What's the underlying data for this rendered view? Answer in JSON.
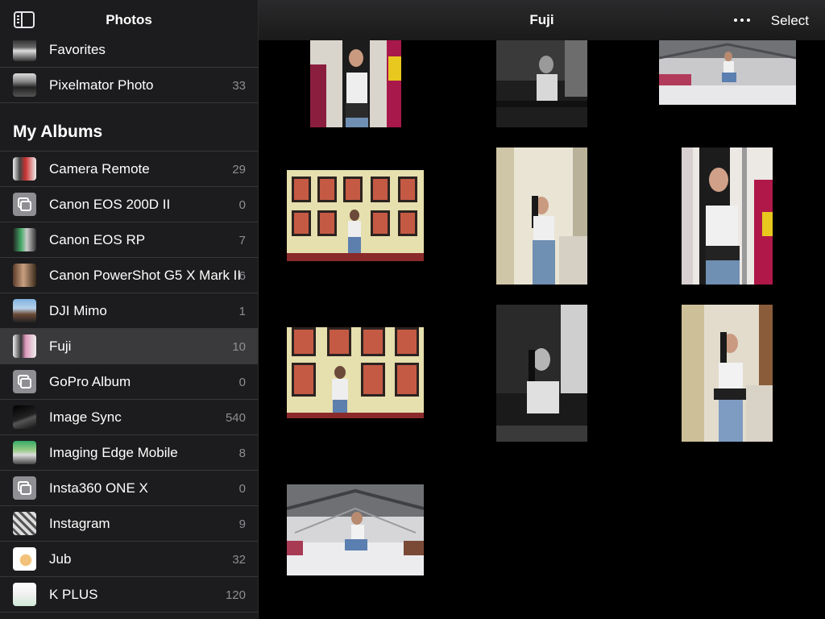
{
  "sidebar": {
    "title": "Photos",
    "top_items": [
      {
        "label": "Favorites",
        "count": ""
      },
      {
        "label": "Pixelmator Photo",
        "count": "33"
      }
    ],
    "section_title": "My Albums",
    "albums": [
      {
        "label": "Camera Remote",
        "count": "29"
      },
      {
        "label": "Canon EOS 200D II",
        "count": "0"
      },
      {
        "label": "Canon EOS RP",
        "count": "7"
      },
      {
        "label": "Canon PowerShot G5 X Mark II",
        "count": "6"
      },
      {
        "label": "DJI Mimo",
        "count": "1"
      },
      {
        "label": "Fuji",
        "count": "10"
      },
      {
        "label": "GoPro Album",
        "count": "0"
      },
      {
        "label": "Image Sync",
        "count": "540"
      },
      {
        "label": "Imaging Edge Mobile",
        "count": "8"
      },
      {
        "label": "Insta360 ONE X",
        "count": "0"
      },
      {
        "label": "Instagram",
        "count": "9"
      },
      {
        "label": "Jub",
        "count": "32"
      },
      {
        "label": "K PLUS",
        "count": "120"
      }
    ],
    "selected": "Fuji"
  },
  "main": {
    "title": "Fuji",
    "select_label": "Select",
    "more_icon": "ellipsis-icon",
    "photo_count": 10
  },
  "colors": {
    "sidebar_bg": "#1c1c1e",
    "selected_row": "#3a3a3c",
    "count_gray": "#8e8e93"
  }
}
